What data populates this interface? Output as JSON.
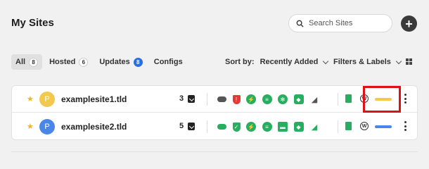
{
  "header": {
    "title": "My Sites",
    "search_placeholder": "Search Sites",
    "add_label": "+"
  },
  "tabs": [
    {
      "label": "All",
      "count": "8"
    },
    {
      "label": "Hosted",
      "count": "6"
    },
    {
      "label": "Updates",
      "count": "8"
    },
    {
      "label": "Configs"
    }
  ],
  "sort": {
    "label": "Sort by:",
    "value": "Recently Added"
  },
  "filters": {
    "label": "Filters & Labels"
  },
  "colors": {
    "green": "#27ae60",
    "red": "#e0101a",
    "yellow_label": "#f2c94c",
    "blue_label": "#4a86e8",
    "star": "#f0b429"
  },
  "sites": [
    {
      "initial": "P",
      "avatar_color": "#f2c94c",
      "name": "examplesite1.tld",
      "updates": "3",
      "label_color": "#f2c94c",
      "status_colors": [
        "#555555",
        "#e53935",
        "#27ae60",
        "#27ae60",
        "#27ae60",
        "#27ae60",
        "#27ae60",
        "#27ae60"
      ]
    },
    {
      "initial": "P",
      "avatar_color": "#4a86e8",
      "name": "examplesite2.tld",
      "updates": "5",
      "label_color": "#4a86e8",
      "status_colors": [
        "#27ae60",
        "#27ae60",
        "#27ae60",
        "#27ae60",
        "#27ae60",
        "#27ae60",
        "#27ae60",
        "#27ae60"
      ]
    }
  ]
}
